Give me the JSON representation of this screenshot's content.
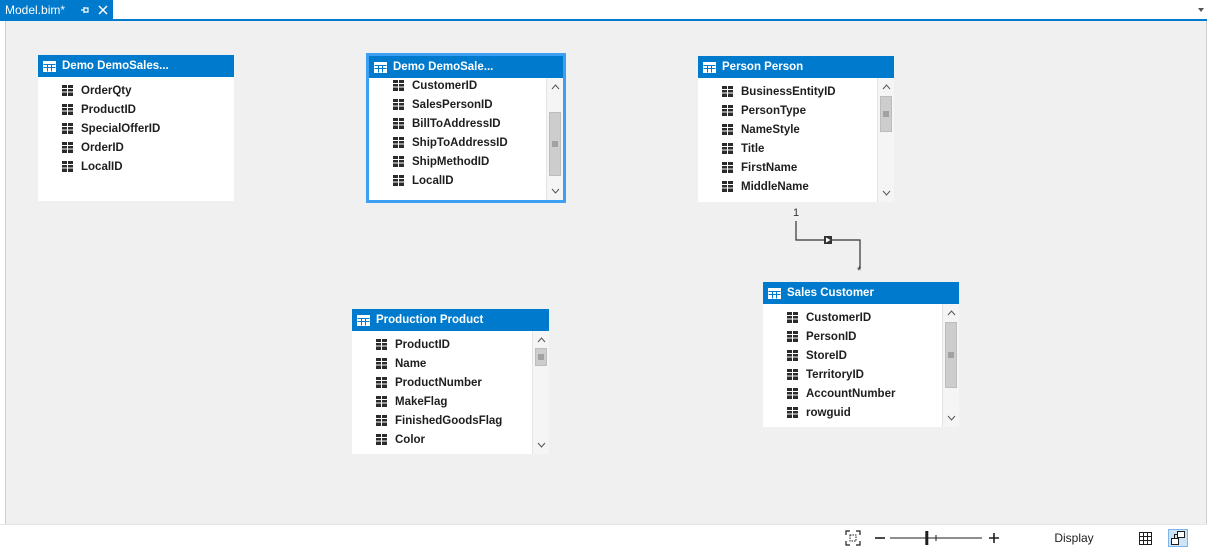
{
  "tab": {
    "title": "Model.bim*",
    "pin_icon": "pin-icon",
    "close_icon": "close-icon"
  },
  "colors": {
    "accent": "#007acc",
    "selection": "#3c9ff3",
    "canvas": "#f0f0f0"
  },
  "tables": [
    {
      "title": "Demo DemoSales...",
      "columns": [
        "OrderQty",
        "ProductID",
        "SpecialOfferID",
        "OrderID",
        "LocalID"
      ]
    },
    {
      "title": "Demo DemoSale...",
      "columns": [
        "CustomerID",
        "SalesPersonID",
        "BillToAddressID",
        "ShipToAddressID",
        "ShipMethodID",
        "LocalID"
      ]
    },
    {
      "title": "Person Person",
      "columns": [
        "BusinessEntityID",
        "PersonType",
        "NameStyle",
        "Title",
        "FirstName",
        "MiddleName"
      ]
    },
    {
      "title": "Production Product",
      "columns": [
        "ProductID",
        "Name",
        "ProductNumber",
        "MakeFlag",
        "FinishedGoodsFlag",
        "Color"
      ]
    },
    {
      "title": "Sales Customer",
      "columns": [
        "CustomerID",
        "PersonID",
        "StoreID",
        "TerritoryID",
        "AccountNumber",
        "rowguid"
      ]
    }
  ],
  "relationship": {
    "from_cardinality": "1",
    "to_cardinality": "*"
  },
  "statusbar": {
    "display_label": "Display",
    "zoom_fraction": 0.4
  }
}
